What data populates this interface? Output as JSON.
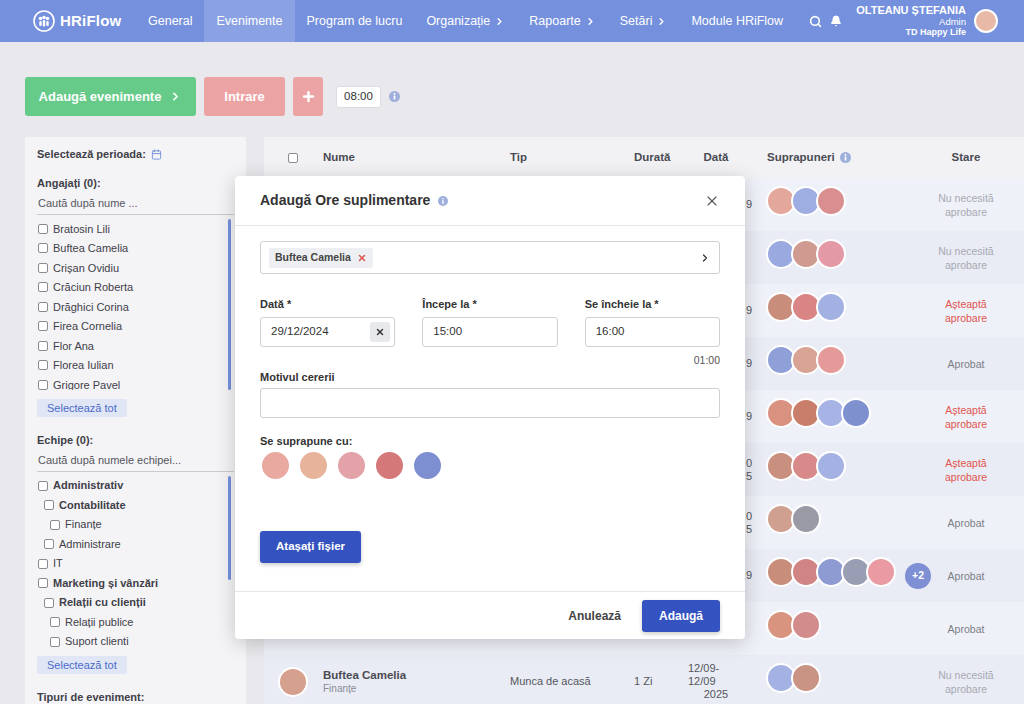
{
  "app": {
    "logo": "HRiFlow"
  },
  "nav": {
    "items": [
      {
        "label": "General",
        "selected": false,
        "has_menu": false
      },
      {
        "label": "Evenimente",
        "selected": true,
        "has_menu": false
      },
      {
        "label": "Program de lucru",
        "selected": false,
        "has_menu": false
      },
      {
        "label": "Organizație",
        "selected": false,
        "has_menu": true
      },
      {
        "label": "Rapoarte",
        "selected": false,
        "has_menu": true
      },
      {
        "label": "Setări",
        "selected": false,
        "has_menu": true
      },
      {
        "label": "Module HRiFlow",
        "selected": false,
        "has_menu": false
      }
    ],
    "user": {
      "name": "OLTEANU ȘTEFANIA",
      "role": "Admin",
      "company": "TD Happy Life",
      "avatar": "#e8b9a6"
    }
  },
  "toolbar": {
    "add_events": "Adaugă evenimente",
    "check_in": "Intrare",
    "time": "08:00"
  },
  "sidebar": {
    "period_label": "Selectează perioada:",
    "employees": {
      "title": "Angajați (0):",
      "placeholder": "Caută după nume ...",
      "select_all": "Selectează tot",
      "items": [
        {
          "label": "Bratosin Lili",
          "checked": false
        },
        {
          "label": "Buftea Camelia",
          "checked": false
        },
        {
          "label": "Crișan Ovidiu",
          "checked": false
        },
        {
          "label": "Crăciun Roberta",
          "checked": false
        },
        {
          "label": "Drăghici Corina",
          "checked": false
        },
        {
          "label": "Firea Cornelia",
          "checked": false
        },
        {
          "label": "Flor Ana",
          "checked": false
        },
        {
          "label": "Florea Iulian",
          "checked": false
        },
        {
          "label": "Grigore Pavel",
          "checked": false
        }
      ]
    },
    "teams": {
      "title": "Echipe (0):",
      "placeholder": "Caută după numele echipei...",
      "select_all": "Selectează tot",
      "items": [
        {
          "label": "Administrativ",
          "level": 0,
          "bold": true,
          "checked": false
        },
        {
          "label": "Contabilitate",
          "level": 1,
          "bold": true,
          "checked": false
        },
        {
          "label": "Finanțe",
          "level": 2,
          "bold": false,
          "checked": false
        },
        {
          "label": "Administrare",
          "level": 1,
          "bold": false,
          "checked": false
        },
        {
          "label": "IT",
          "level": 0,
          "bold": false,
          "checked": false
        },
        {
          "label": "Marketing și vânzări",
          "level": 0,
          "bold": true,
          "checked": false
        },
        {
          "label": "Relații cu clienții",
          "level": 1,
          "bold": true,
          "checked": false
        },
        {
          "label": "Relații publice",
          "level": 2,
          "bold": false,
          "checked": false
        },
        {
          "label": "Suport clienti",
          "level": 2,
          "bold": false,
          "checked": false
        }
      ]
    },
    "event_types_label": "Tipuri de eveniment:"
  },
  "table": {
    "select_all_checked": false,
    "columns": [
      {
        "label": "Nume",
        "info": false
      },
      {
        "label": "Tip",
        "info": false
      },
      {
        "label": "Durată",
        "info": false
      },
      {
        "label": "Dată",
        "info": false
      },
      {
        "label": "Suprapuneri",
        "info": true
      },
      {
        "label": "Stare",
        "info": false
      }
    ],
    "rows": [
      {
        "kind": "covered",
        "date": [
          "9"
        ],
        "avatars": [
          "#e3a79c",
          "#9eaee3",
          "#d98f8f"
        ],
        "more": null,
        "status": "Nu necesită aprobare",
        "color": "#a7a9b2"
      },
      {
        "kind": "covered",
        "date": [],
        "avatars": [
          "#9aa9df",
          "#cf9a8f",
          "#e39aa6"
        ],
        "more": null,
        "status": "Nu necesită aprobare",
        "color": "#a7a9b2"
      },
      {
        "kind": "covered",
        "date": [
          "9"
        ],
        "avatars": [
          "#c98d7c",
          "#d98585",
          "#a2b0e2"
        ],
        "more": null,
        "status": "Așteaptă aprobare",
        "color": "#e0544f"
      },
      {
        "kind": "covered",
        "date": [
          "9"
        ],
        "avatars": [
          "#8f9fd8",
          "#d7a495",
          "#e59a9a"
        ],
        "more": null,
        "status": "Aprobat",
        "color": "#7c7e87"
      },
      {
        "kind": "covered",
        "date": [
          "9"
        ],
        "avatars": [
          "#d9927f",
          "#c97e6c",
          "#a6b3e4",
          "#7f90cf"
        ],
        "more": null,
        "status": "Așteaptă aprobare",
        "color": "#e0544f"
      },
      {
        "kind": "covered",
        "date": [
          "0",
          "5"
        ],
        "avatars": [
          "#c98f7f",
          "#d88a8a",
          "#a3b1e3"
        ],
        "more": null,
        "status": "Așteaptă aprobare",
        "color": "#e0544f"
      },
      {
        "kind": "covered",
        "date": [
          "0",
          "5"
        ],
        "avatars": [
          "#cfa08f",
          "#9a9aa6"
        ],
        "more": null,
        "status": "Aprobat",
        "color": "#7c7e87"
      },
      {
        "kind": "covered",
        "date": [
          "9"
        ],
        "avatars": [
          "#c98d7c",
          "#d08484",
          "#8d9bd2",
          "#9a9eb5",
          "#e99aa2"
        ],
        "more": "+2",
        "status": "Aprobat",
        "color": "#7c7e87"
      },
      {
        "kind": "covered",
        "date": [],
        "avatars": [
          "#d9947f",
          "#d38c8c"
        ],
        "more": null,
        "status": "Aprobat",
        "color": "#7c7e87"
      },
      {
        "kind": "full",
        "avatar": "#d6a08e",
        "name": "Buftea Camelia",
        "team": "Finanțe",
        "type": "Munca de acasă",
        "duration": "1 Zi",
        "date": [
          "12/09-12/09",
          "2025"
        ],
        "avatars": [
          "#a3b1e3",
          "#c99484"
        ],
        "more": null,
        "status": "Nu necesită aprobare",
        "color": "#a7a9b2"
      }
    ]
  },
  "dialog": {
    "title": "Adaugă Ore suplimentare",
    "employee_chip": "Buftea Camelia",
    "date_label": "Dată *",
    "date_value": "29/12/2024",
    "start_label": "Începe la *",
    "start_value": "15:00",
    "end_label": "Se încheie la *",
    "end_value": "16:00",
    "duration": "01:00",
    "reason_label": "Motivul cererii",
    "reason_value": "",
    "overlap_label": "Se suprapune cu:",
    "overlap_avatars": [
      "#e9a9a0",
      "#e6b49a",
      "#e2a2a8",
      "#d4787a",
      "#7d8fd0"
    ],
    "attach_button": "Atașați fișier",
    "cancel_button": "Anulează",
    "add_button": "Adaugă"
  }
}
